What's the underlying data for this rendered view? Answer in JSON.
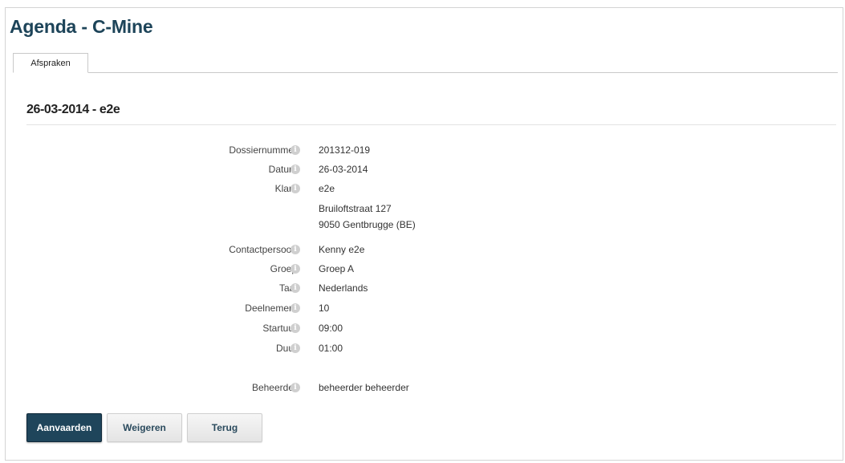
{
  "page": {
    "title": "Agenda - C-Mine"
  },
  "tabs": [
    {
      "label": "Afspraken",
      "active": true
    }
  ],
  "section": {
    "title": "26-03-2014 - e2e"
  },
  "fields": [
    {
      "label": "Dossiernummer",
      "value": "201312-019"
    },
    {
      "label": "Datum",
      "value": "26-03-2014"
    },
    {
      "label": "Klant",
      "value": "e2e",
      "address_line1": "Bruiloftstraat 127",
      "address_line2": "9050 Gentbrugge (BE)"
    },
    {
      "label": "Contactpersoon",
      "value": "Kenny e2e"
    },
    {
      "label": "Groep",
      "value": "Groep A"
    },
    {
      "label": "Taal",
      "value": "Nederlands"
    },
    {
      "label": "Deelnemers",
      "value": "10"
    },
    {
      "label": "Startuur",
      "value": "09:00"
    },
    {
      "label": "Duur",
      "value": "01:00"
    },
    {
      "label": "Beheerder",
      "value": "beheerder beheerder"
    }
  ],
  "info_icon": {
    "name": "info-icon",
    "glyph": "i",
    "color": "#cfcfcf"
  },
  "buttons": {
    "accept_label": "Aanvaarden",
    "refuse_label": "Weigeren",
    "back_label": "Terug"
  },
  "colors": {
    "title": "#1d4459",
    "primary_button": "#1f455b"
  }
}
